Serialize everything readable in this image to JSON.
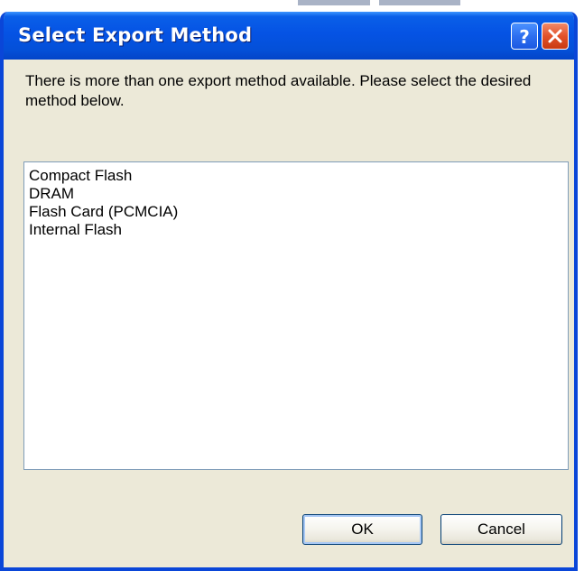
{
  "dialog": {
    "title": "Select Export Method",
    "message": "There is more than one export method available. Please select the desired method below.",
    "titlebar_color": "#0553e4",
    "frame_color": "#0a46d8",
    "body_color": "#ece9d8"
  },
  "titlebar_buttons": {
    "help_icon": "question-mark-icon",
    "close_icon": "x-close-icon"
  },
  "methods": [
    "Compact Flash",
    "DRAM",
    "Flash Card (PCMCIA)",
    "Internal Flash"
  ],
  "buttons": {
    "ok_label": "OK",
    "cancel_label": "Cancel"
  }
}
